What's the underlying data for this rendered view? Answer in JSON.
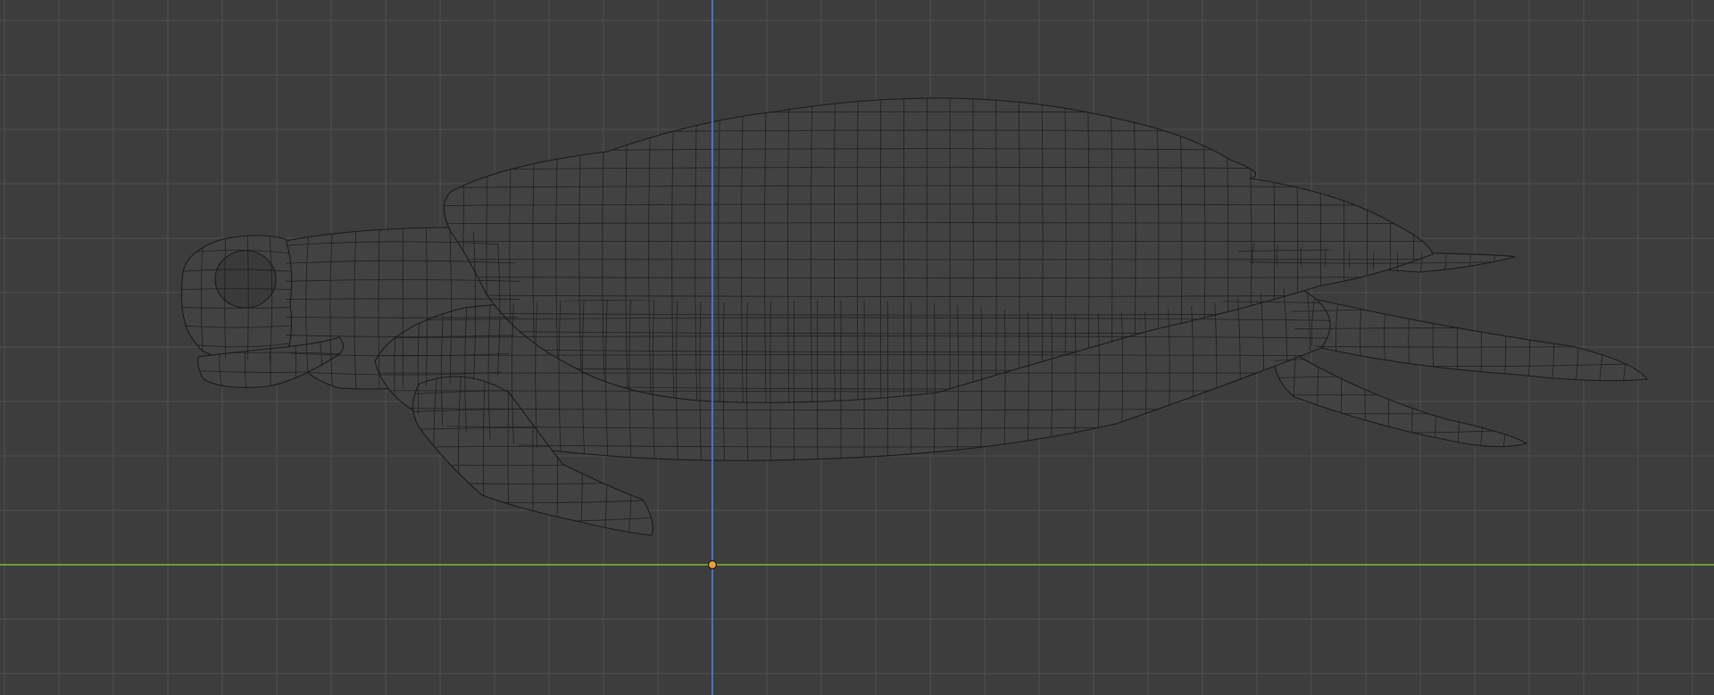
{
  "viewport": {
    "mode": "wireframe",
    "view": "side",
    "object": "sea-turtle-mesh",
    "axes": [
      "z-axis",
      "y-axis"
    ]
  },
  "colors": {
    "background": "#3d3d3d",
    "grid_line": "#4a4a4a",
    "axis_vertical": "#4f72b8",
    "axis_horizontal": "#6f9b3b",
    "origin_fill": "#f0a030",
    "origin_stroke": "#1e1e1e",
    "wire": "#1b1b1b",
    "mesh_fill": "#424242"
  },
  "icons": {
    "origin": "origin-point-icon"
  }
}
